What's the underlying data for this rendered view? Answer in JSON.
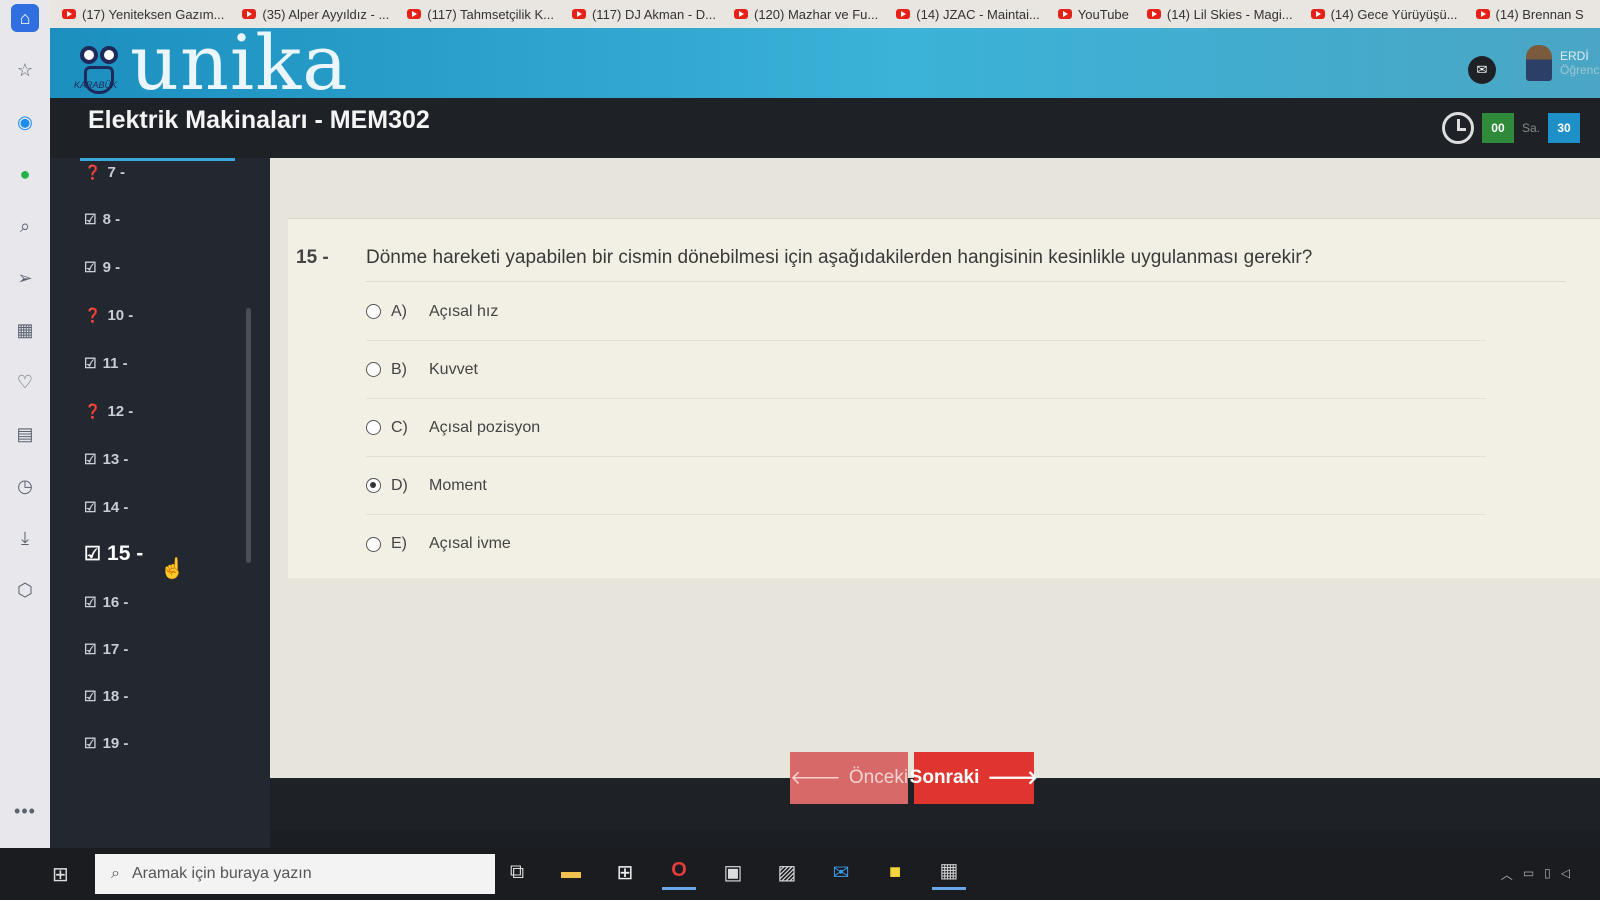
{
  "bookmarks": [
    {
      "label": "(17) Yeniteksen Gazım..."
    },
    {
      "label": "(35) Alper Ayyıldız - ..."
    },
    {
      "label": "(117) Tahmsetçilik K..."
    },
    {
      "label": "(117) DJ Akman - D..."
    },
    {
      "label": "(120) Mazhar ve Fu..."
    },
    {
      "label": "(14) JZAC - Maintai..."
    },
    {
      "label": "YouTube"
    },
    {
      "label": "(14) Lil Skies - Magi..."
    },
    {
      "label": "(14) Gece Yürüyüşü..."
    },
    {
      "label": "(14) Brennan S"
    }
  ],
  "header": {
    "logo_text": "unika",
    "logo_tag": "KARABÜK",
    "user_name": "ERDİ",
    "user_role": "Öğrenci"
  },
  "course": {
    "title": "Elektrik Makinaları - MEM302"
  },
  "timer": {
    "hours": "00",
    "hours_label": "Sa.",
    "minutes": "30"
  },
  "navigator": {
    "items": [
      {
        "num": "7 -",
        "status": "unanswered"
      },
      {
        "num": "8 -",
        "status": "answered"
      },
      {
        "num": "9 -",
        "status": "answered"
      },
      {
        "num": "10 -",
        "status": "unanswered"
      },
      {
        "num": "11 -",
        "status": "answered"
      },
      {
        "num": "12 -",
        "status": "unanswered"
      },
      {
        "num": "13 -",
        "status": "answered"
      },
      {
        "num": "14 -",
        "status": "answered"
      },
      {
        "num": "15 -",
        "status": "answered",
        "current": true
      },
      {
        "num": "16 -",
        "status": "answered"
      },
      {
        "num": "17 -",
        "status": "answered"
      },
      {
        "num": "18 -",
        "status": "answered"
      },
      {
        "num": "19 -",
        "status": "answered"
      }
    ]
  },
  "question": {
    "number": "15 -",
    "text": "Dönme hareketi yapabilen bir cismin dönebilmesi için aşağıdakilerden hangisinin kesinlikle uygulanması gerekir?",
    "options": [
      {
        "letter": "A)",
        "text": "Açısal hız",
        "selected": false
      },
      {
        "letter": "B)",
        "text": "Kuvvet",
        "selected": false
      },
      {
        "letter": "C)",
        "text": "Açısal pozisyon",
        "selected": false
      },
      {
        "letter": "D)",
        "text": "Moment",
        "selected": true
      },
      {
        "letter": "E)",
        "text": "Açısal ivme",
        "selected": false
      }
    ]
  },
  "buttons": {
    "prev": "Önceki",
    "next": "Sonraki"
  },
  "taskbar": {
    "search_placeholder": "Aramak için buraya yazın"
  },
  "colors": {
    "header": "#3bb2d8",
    "next_button": "#e0352f",
    "timer_green": "#2f8b3a",
    "timer_blue": "#1f8fc7"
  }
}
